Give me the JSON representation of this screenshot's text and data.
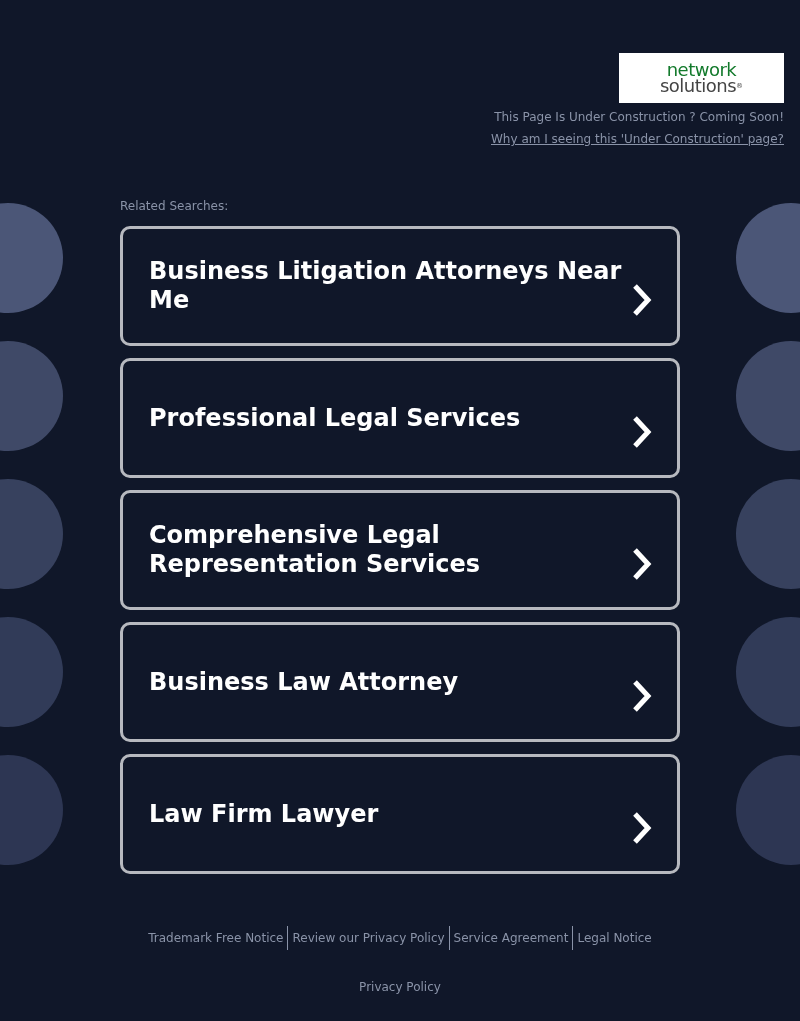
{
  "logo": {
    "line_1": "network",
    "line_2": "solutions",
    "mark": "®"
  },
  "notice": "This Page Is Under Construction ? Coming Soon!",
  "why_link": "Why am I seeing this 'Under Construction' page?",
  "related_label": "Related Searches:",
  "searches": [
    {
      "label": "Business Litigation Attorneys Near Me"
    },
    {
      "label": "Professional Legal Services"
    },
    {
      "label": "Comprehensive Legal Representation Services"
    },
    {
      "label": "Business Law Attorney"
    },
    {
      "label": "Law Firm Lawyer"
    }
  ],
  "footer_links": [
    "Trademark Free Notice",
    "Review our Privacy Policy",
    "Service Agreement",
    "Legal Notice"
  ],
  "privacy_link": "Privacy Policy"
}
